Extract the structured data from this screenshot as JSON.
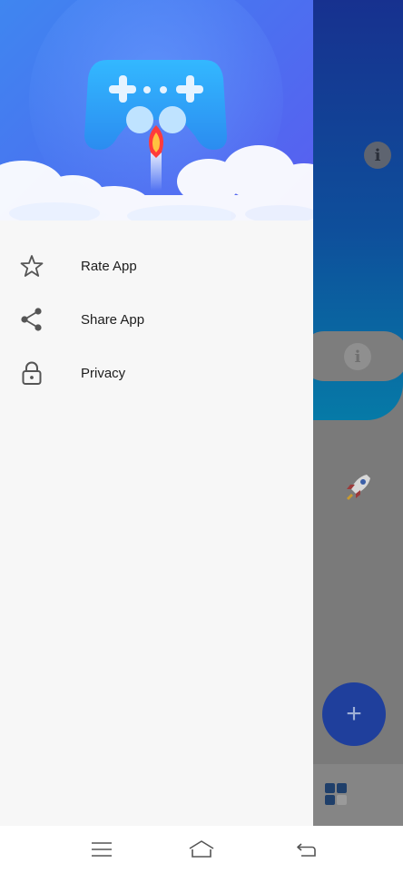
{
  "drawer": {
    "menu_items": [
      {
        "label": "Rate App",
        "icon": "star-outline-icon"
      },
      {
        "label": "Share App",
        "icon": "share-icon"
      },
      {
        "label": "Privacy",
        "icon": "lock-icon"
      }
    ]
  },
  "background_app": {
    "fab_label": "+",
    "info_glyph": "i"
  },
  "navbar": {
    "buttons": [
      "menu-icon",
      "home-icon",
      "back-icon"
    ]
  },
  "colors": {
    "drawer_header_gradient_start": "#3f86f0",
    "drawer_header_gradient_end": "#5a5df0",
    "drawer_background": "#f7f7f7",
    "app_header_dark": "#17318f",
    "fab": "#1f3f9c"
  }
}
